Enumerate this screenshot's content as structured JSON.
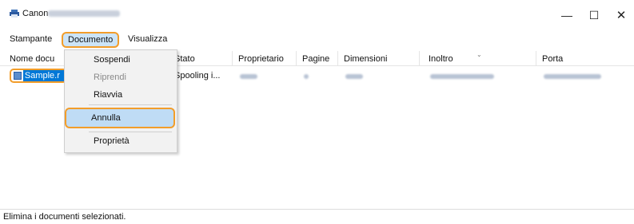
{
  "window": {
    "title": "Canon",
    "minimize_glyph": "—",
    "maximize_glyph": "☐",
    "close_glyph": "✕",
    "accent_color": "#f29d2a",
    "selection_color": "#0078d7"
  },
  "menubar": {
    "stampante": "Stampante",
    "documento": "Documento",
    "visualizza": "Visualizza"
  },
  "columns": {
    "nome": "Nome docu",
    "stato": "Stato",
    "proprietario": "Proprietario",
    "pagine": "Pagine",
    "dimensioni": "Dimensioni",
    "inoltro": "Inoltro",
    "porta": "Porta"
  },
  "row": {
    "document_name": "Sample.r",
    "status": "Spooling i..."
  },
  "dropdown": {
    "sospendi": "Sospendi",
    "riprendi": "Riprendi",
    "riavvia": "Riavvia",
    "annulla": "Annulla",
    "proprieta": "Proprietà"
  },
  "statusbar": {
    "text": "Elimina i documenti selezionati."
  },
  "icons": {
    "app": "printer-icon",
    "document": "document-icon"
  }
}
